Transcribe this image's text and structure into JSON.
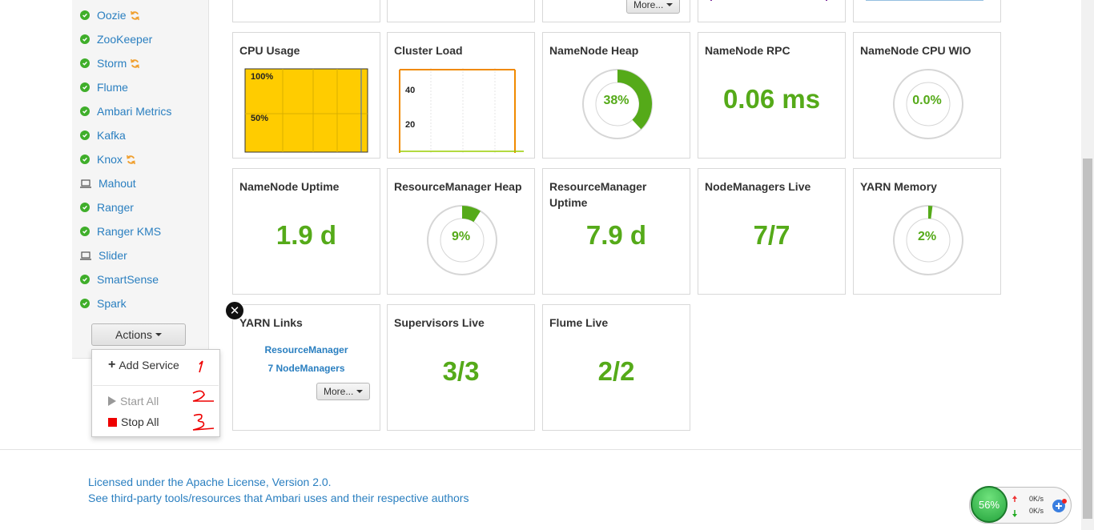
{
  "sidebar": {
    "services": [
      {
        "label": "Oozie",
        "status": "ok",
        "refresh": true
      },
      {
        "label": "ZooKeeper",
        "status": "ok",
        "refresh": false
      },
      {
        "label": "Storm",
        "status": "ok",
        "refresh": true
      },
      {
        "label": "Flume",
        "status": "ok",
        "refresh": false
      },
      {
        "label": "Ambari Metrics",
        "status": "ok",
        "refresh": false
      },
      {
        "label": "Kafka",
        "status": "ok",
        "refresh": false
      },
      {
        "label": "Knox",
        "status": "ok",
        "refresh": true
      },
      {
        "label": "Mahout",
        "status": "client",
        "refresh": false
      },
      {
        "label": "Ranger",
        "status": "ok",
        "refresh": false
      },
      {
        "label": "Ranger KMS",
        "status": "ok",
        "refresh": false
      },
      {
        "label": "Slider",
        "status": "client",
        "refresh": false
      },
      {
        "label": "SmartSense",
        "status": "ok",
        "refresh": false
      },
      {
        "label": "Spark",
        "status": "ok",
        "refresh": false
      }
    ],
    "actions_label": "Actions",
    "menu": {
      "add_service": "Add Service",
      "start_all": "Start All",
      "stop_all": "Stop All"
    }
  },
  "widgets": {
    "top_more": "More...",
    "cpu_usage": {
      "title": "CPU Usage",
      "tick_100": "100%",
      "tick_50": "50%"
    },
    "cluster_load": {
      "title": "Cluster Load",
      "tick_40": "40",
      "tick_20": "20"
    },
    "namenode_heap": {
      "title": "NameNode Heap",
      "value": "38%",
      "fraction": 0.38
    },
    "namenode_rpc": {
      "title": "NameNode RPC",
      "value": "0.06 ms"
    },
    "namenode_cpu_wio": {
      "title": "NameNode CPU WIO",
      "value": "0.0%",
      "fraction": 0.0
    },
    "namenode_uptime": {
      "title": "NameNode Uptime",
      "value": "1.9 d"
    },
    "rm_heap": {
      "title": "ResourceManager Heap",
      "value": "9%",
      "fraction": 0.09
    },
    "rm_uptime": {
      "title": "ResourceManager Uptime",
      "value": "7.9 d"
    },
    "nodemanagers_live": {
      "title": "NodeManagers Live",
      "value": "7/7"
    },
    "yarn_memory": {
      "title": "YARN Memory",
      "value": "2%",
      "fraction": 0.02
    },
    "yarn_links": {
      "title": "YARN Links",
      "link1": "ResourceManager",
      "link2": "7 NodeManagers",
      "more": "More..."
    },
    "supervisors_live": {
      "title": "Supervisors Live",
      "value": "3/3"
    },
    "flume_live": {
      "title": "Flume Live",
      "value": "2/2"
    }
  },
  "footer": {
    "license": "Licensed under the Apache License, Version 2.0.",
    "third_party": "See third-party tools/resources that Ambari uses and their respective authors"
  },
  "netmon": {
    "percent": "56%",
    "up": "0K/s",
    "down": "0K/s"
  },
  "colors": {
    "ok": "#3fae2a",
    "link": "#2a7fc0",
    "metric": "#55aa19",
    "stop": "#ee0000"
  }
}
